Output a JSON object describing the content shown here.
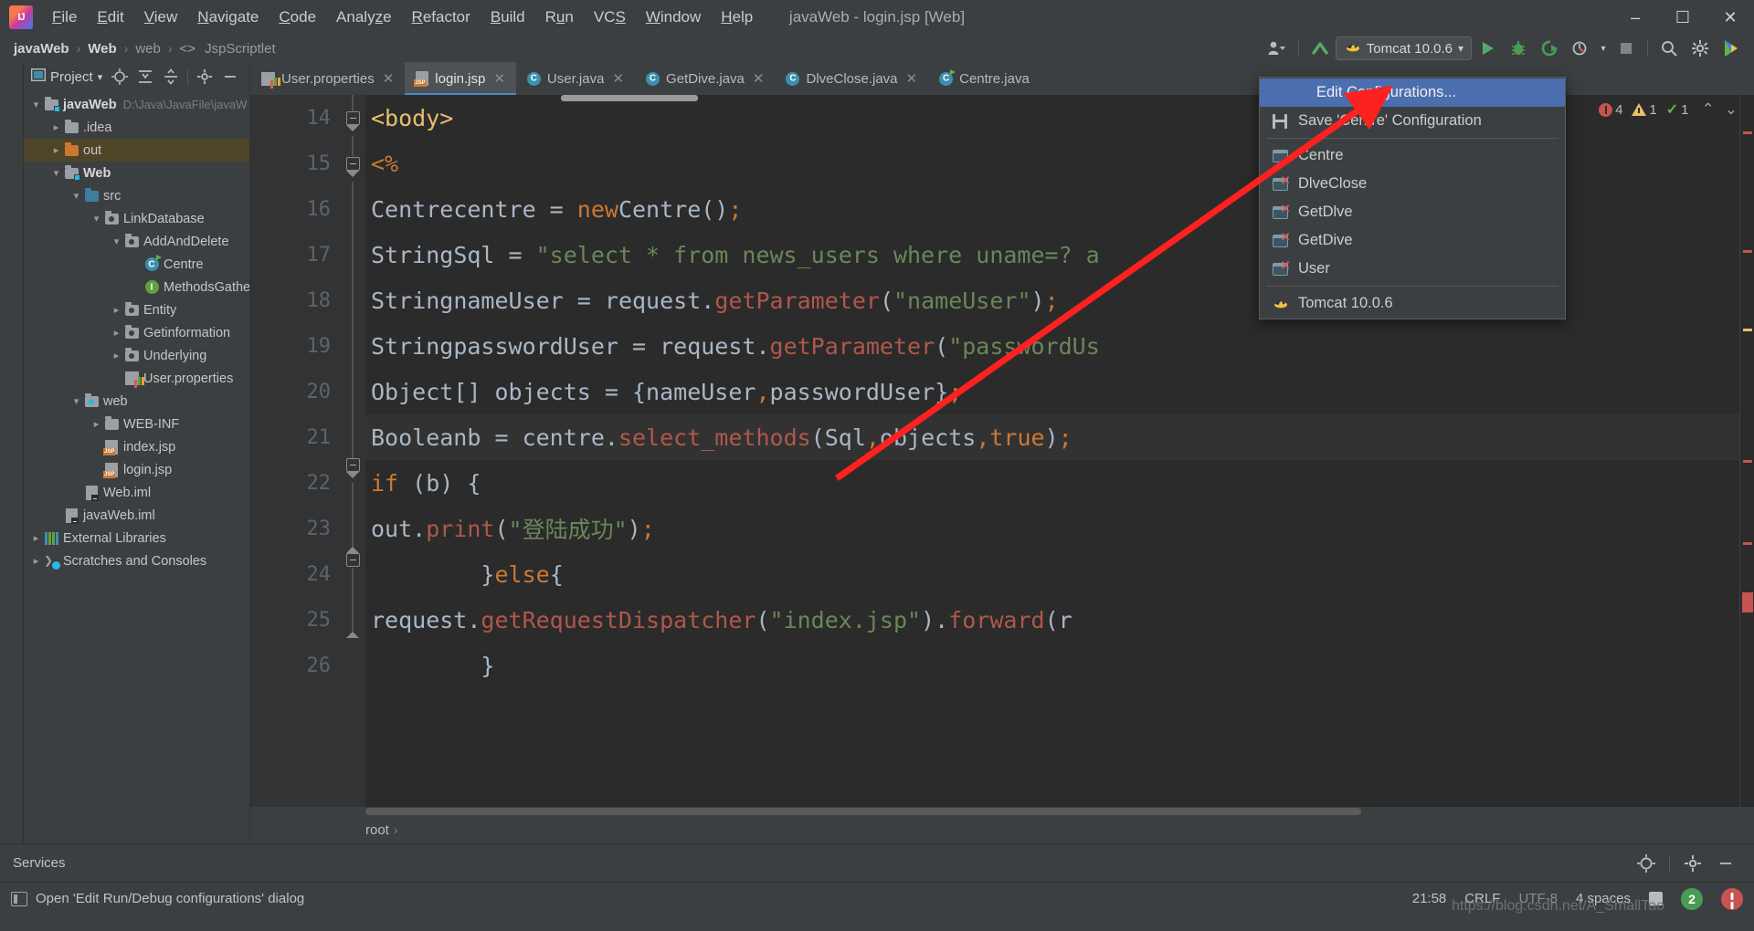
{
  "window": {
    "title": "javaWeb - login.jsp [Web]",
    "minimize": "–",
    "maximize": "☐",
    "close": "✕"
  },
  "menubar": {
    "items": [
      {
        "label": "File"
      },
      {
        "label": "Edit"
      },
      {
        "label": "View"
      },
      {
        "label": "Navigate"
      },
      {
        "label": "Code"
      },
      {
        "label": "Analyze"
      },
      {
        "label": "Refactor"
      },
      {
        "label": "Build"
      },
      {
        "label": "Run"
      },
      {
        "label": "VCS"
      },
      {
        "label": "Window"
      },
      {
        "label": "Help"
      }
    ]
  },
  "breadcrumb": {
    "items": [
      {
        "label": "javaWeb",
        "style": "bold"
      },
      {
        "label": "Web",
        "style": "bold"
      },
      {
        "label": "web",
        "style": "dim"
      },
      {
        "label": "JspScriptlet",
        "style": "dim",
        "icon": "angle-brackets-icon"
      }
    ],
    "separator": "›"
  },
  "toolbar": {
    "user_icon": "user-settings-icon",
    "updates_icon": "vcs-update-icon",
    "run_config": {
      "label": "Tomcat 10.0.6",
      "icon": "tomcat-icon",
      "chevron": "▾"
    },
    "run_label": "Run",
    "debug_label": "Debug",
    "run_coverage_label": "Run with Coverage",
    "profile_label": "Profile",
    "stop_label": "Stop",
    "search_label": "Search Everywhere",
    "settings_label": "Settings",
    "plugin_label": "IDE Assistant"
  },
  "run_config_menu": {
    "highlighted": "Edit Configurations...",
    "items": [
      {
        "label": "Edit Configurations...",
        "icon": "none",
        "highlighted": true
      },
      {
        "label": "Save 'Centre' Configuration",
        "icon": "save-icon"
      },
      {
        "separator": true
      },
      {
        "label": "Centre",
        "icon": "config-icon"
      },
      {
        "label": "DlveClose",
        "icon": "config-temp-icon"
      },
      {
        "label": "GetDlve",
        "icon": "config-temp-icon"
      },
      {
        "label": "GetDive",
        "icon": "config-temp-icon"
      },
      {
        "label": "User",
        "icon": "config-temp-icon"
      },
      {
        "separator": true
      },
      {
        "label": "Tomcat 10.0.6",
        "icon": "tomcat-icon"
      }
    ]
  },
  "project_panel": {
    "title": "Project",
    "title_chevron": "▾",
    "tools": [
      "locate-icon",
      "expand-all-icon",
      "collapse-all-icon",
      "gear-icon",
      "hide-icon"
    ],
    "tree": [
      {
        "depth": 0,
        "arrow": "down",
        "icon": "module-folder-icon",
        "label": "javaWeb",
        "bold": true,
        "path": "D:\\Java\\JavaFile\\javaW",
        "selected": false
      },
      {
        "depth": 1,
        "arrow": "right",
        "icon": "folder-gray-icon",
        "label": ".idea",
        "bold": false,
        "selected": false
      },
      {
        "depth": 1,
        "arrow": "right",
        "icon": "folder-orange-icon",
        "label": "out",
        "bold": false,
        "selected": true
      },
      {
        "depth": 1,
        "arrow": "down",
        "icon": "module-folder-icon",
        "label": "Web",
        "bold": true,
        "selected": false
      },
      {
        "depth": 2,
        "arrow": "down",
        "icon": "source-root-icon",
        "label": "src",
        "bold": false,
        "selected": false
      },
      {
        "depth": 3,
        "arrow": "down",
        "icon": "package-icon",
        "label": "LinkDatabase",
        "bold": false,
        "selected": false
      },
      {
        "depth": 4,
        "arrow": "down",
        "icon": "package-icon",
        "label": "AddAndDelete",
        "bold": false,
        "selected": false
      },
      {
        "depth": 5,
        "arrow": "none",
        "icon": "class-runnable-icon",
        "label": "Centre",
        "bold": false,
        "selected": false
      },
      {
        "depth": 5,
        "arrow": "none",
        "icon": "interface-icon",
        "label": "MethodsGather",
        "bold": false,
        "selected": false
      },
      {
        "depth": 4,
        "arrow": "right",
        "icon": "package-icon",
        "label": "Entity",
        "bold": false,
        "selected": false
      },
      {
        "depth": 4,
        "arrow": "right",
        "icon": "package-icon",
        "label": "Getinformation",
        "bold": false,
        "selected": false
      },
      {
        "depth": 4,
        "arrow": "right",
        "icon": "package-icon",
        "label": "Underlying",
        "bold": false,
        "selected": false
      },
      {
        "depth": 4,
        "arrow": "none",
        "icon": "properties-icon",
        "label": "User.properties",
        "bold": false,
        "selected": false
      },
      {
        "depth": 2,
        "arrow": "down",
        "icon": "web-root-icon",
        "label": "web",
        "bold": false,
        "selected": false
      },
      {
        "depth": 3,
        "arrow": "right",
        "icon": "folder-gray-icon",
        "label": "WEB-INF",
        "bold": false,
        "selected": false
      },
      {
        "depth": 3,
        "arrow": "none",
        "icon": "jsp-icon",
        "label": "index.jsp",
        "bold": false,
        "selected": false
      },
      {
        "depth": 3,
        "arrow": "none",
        "icon": "jsp-icon",
        "label": "login.jsp",
        "bold": false,
        "selected": false
      },
      {
        "depth": 2,
        "arrow": "none",
        "icon": "iml-icon",
        "label": "Web.iml",
        "bold": false,
        "selected": false
      },
      {
        "depth": 1,
        "arrow": "none",
        "icon": "iml-icon",
        "label": "javaWeb.iml",
        "bold": false,
        "selected": false
      },
      {
        "depth": 0,
        "arrow": "right",
        "icon": "library-icon",
        "label": "External Libraries",
        "bold": false,
        "selected": false
      },
      {
        "depth": 0,
        "arrow": "right",
        "icon": "scratch-icon",
        "label": "Scratches and Consoles",
        "bold": false,
        "selected": false
      }
    ]
  },
  "editor_tabs": [
    {
      "label": "User.properties",
      "icon": "properties-icon",
      "active": false,
      "close": "✕"
    },
    {
      "label": "login.jsp",
      "icon": "jsp-icon",
      "active": true,
      "close": "✕"
    },
    {
      "label": "User.java",
      "icon": "class-icon",
      "active": false,
      "close": "✕"
    },
    {
      "label": "GetDive.java",
      "icon": "class-icon",
      "active": false,
      "close": "✕"
    },
    {
      "label": "DlveClose.java",
      "icon": "class-icon",
      "active": false,
      "close": "✕"
    },
    {
      "label": "Centre.java",
      "icon": "class-runnable-icon",
      "active": false,
      "close": ""
    }
  ],
  "inspections": {
    "errors": "4",
    "warnings": "1",
    "checks": "1",
    "up": "⌃",
    "down": "⌄"
  },
  "code": {
    "lines": [
      {
        "num": "14",
        "text": "<body>",
        "highlight": false
      },
      {
        "num": "15",
        "text": "    <%",
        "highlight": false
      },
      {
        "num": "16",
        "text": "        Centre centre = new Centre();",
        "highlight": false
      },
      {
        "num": "17",
        "text": "        String Sql = \"select * from news_users where uname=? a",
        "highlight": false
      },
      {
        "num": "18",
        "text": "        String nameUser = request.getParameter(\"nameUser\");",
        "highlight": false
      },
      {
        "num": "19",
        "text": "        String passwordUser = request.getParameter(\"passwordUs",
        "highlight": false
      },
      {
        "num": "20",
        "text": "        Object[] objects = {nameUser,passwordUser};",
        "highlight": false
      },
      {
        "num": "21",
        "text": "        Boolean b = centre.select_methods(Sql,objects,true);",
        "highlight": true
      },
      {
        "num": "22",
        "text": "        if (b) {",
        "highlight": false
      },
      {
        "num": "23",
        "text": "            out.print(\"登陆成功\");",
        "highlight": false
      },
      {
        "num": "24",
        "text": "        }else{",
        "highlight": false
      },
      {
        "num": "25",
        "text": "            request.getRequestDispatcher(\"index.jsp\").forward(r",
        "highlight": false
      },
      {
        "num": "26",
        "text": "        }",
        "highlight": false
      }
    ],
    "bottom_breadcrumb": "root",
    "bottom_breadcrumb_sep": "›"
  },
  "services": {
    "label": "Services",
    "gear_icon": "gear-icon",
    "locate_icon": "locate-icon",
    "hide_icon": "hide-icon"
  },
  "statusbar": {
    "message": "Open 'Edit Run/Debug configurations' dialog",
    "message_icon": "dialog-icon",
    "time": "21:58",
    "line_separator": "CRLF",
    "encoding": "UTF-8",
    "indent": "4 spaces",
    "git_branch": "",
    "notification_count": "2",
    "lock_icon": "lock-icon"
  },
  "watermark": "https://blog.csdn.net/A_SmallTao",
  "colors": {
    "accent_blue": "#4b6eaf",
    "editor_bg": "#2b2b2b",
    "panel_bg": "#3c3f41",
    "selected_row": "#4e4528",
    "keyword": "#cc7832",
    "string": "#6a8759",
    "method": "#b1574b",
    "tag": "#e8bf6a",
    "text": "#a9b7c6",
    "annotation_arrow": "#ff2020"
  }
}
